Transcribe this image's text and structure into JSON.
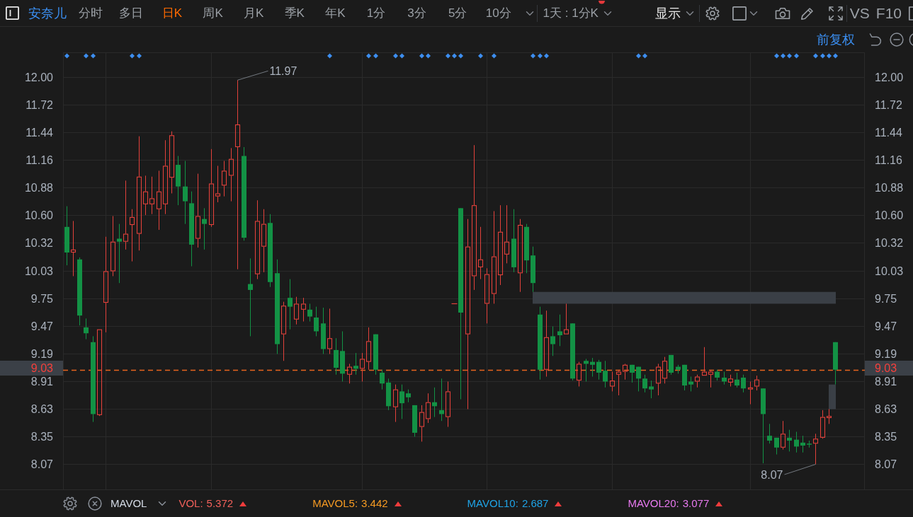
{
  "toolbar": {
    "stock_name": "安奈儿",
    "periods": [
      {
        "label": "分时",
        "selected": false
      },
      {
        "label": "多日",
        "selected": false
      },
      {
        "label": "日K",
        "selected": true
      },
      {
        "label": "周K",
        "selected": false
      },
      {
        "label": "月K",
        "selected": false
      },
      {
        "label": "季K",
        "selected": false
      },
      {
        "label": "年K",
        "selected": false
      },
      {
        "label": "1分",
        "selected": false
      },
      {
        "label": "3分",
        "selected": false
      },
      {
        "label": "5分",
        "selected": false
      },
      {
        "label": "10分",
        "selected": false
      }
    ],
    "range": {
      "label": "1天 : 1分K",
      "notification": true
    },
    "display_menu": "显示",
    "compare": "VS",
    "f10": "F10"
  },
  "subheader": {
    "adjustment": "前复权"
  },
  "left_axis": {
    "last_price": "9.03"
  },
  "chart": {
    "high_label": "11.97",
    "low_label": "8.07",
    "chart_data": {
      "type": "candlestick",
      "categories": [
        null,
        null,
        null,
        null,
        null,
        null,
        null,
        null,
        null,
        null,
        null,
        null,
        null,
        null,
        null,
        null,
        null,
        null,
        null,
        null,
        null,
        null,
        null,
        null,
        null,
        null,
        null,
        null,
        null,
        null,
        null,
        null,
        null,
        null,
        null,
        null,
        null,
        null,
        null,
        null,
        null,
        null,
        null,
        null,
        null,
        null,
        null,
        null,
        null,
        null,
        null,
        null,
        null,
        null,
        null,
        null,
        null,
        null,
        null,
        null,
        null,
        null,
        null,
        null,
        null,
        null,
        null,
        null,
        null,
        null,
        null,
        null,
        null,
        null,
        null,
        null,
        null,
        null,
        null,
        null,
        null,
        null,
        null,
        null,
        null,
        null,
        null,
        null,
        null,
        null,
        null,
        null,
        null,
        null,
        null,
        null,
        null,
        null,
        null,
        null,
        null,
        null,
        null,
        null,
        null,
        null,
        null,
        null,
        null,
        null,
        null,
        null,
        null,
        null,
        null,
        null,
        null,
        null,
        null,
        null,
        null,
        null
      ],
      "ohlc": [
        [
          10.48,
          10.69,
          10.09,
          10.22
        ],
        [
          10.22,
          10.54,
          9.98,
          10.25
        ],
        [
          10.15,
          10.17,
          9.48,
          9.58
        ],
        [
          9.46,
          9.55,
          9.34,
          9.4
        ],
        [
          9.31,
          9.37,
          8.5,
          8.58
        ],
        [
          8.57,
          9.44,
          8.56,
          9.44
        ],
        [
          9.71,
          10.38,
          9.41,
          10.03
        ],
        [
          10.03,
          10.59,
          9.98,
          10.33
        ],
        [
          10.36,
          10.51,
          9.91,
          10.33
        ],
        [
          10.33,
          10.95,
          10.25,
          10.41
        ],
        [
          10.5,
          10.66,
          10.13,
          10.58
        ],
        [
          10.41,
          11.4,
          10.24,
          10.99
        ],
        [
          10.71,
          11.0,
          10.6,
          10.84
        ],
        [
          10.71,
          10.99,
          10.61,
          10.77
        ],
        [
          10.66,
          11.05,
          10.45,
          10.84
        ],
        [
          10.71,
          11.36,
          10.61,
          11.1
        ],
        [
          10.98,
          11.45,
          10.82,
          11.41
        ],
        [
          11.11,
          11.2,
          10.7,
          10.89
        ],
        [
          10.89,
          11.15,
          10.51,
          10.74
        ],
        [
          10.72,
          10.84,
          10.08,
          10.3
        ],
        [
          10.36,
          11.02,
          10.27,
          10.59
        ],
        [
          10.56,
          10.67,
          10.25,
          10.51
        ],
        [
          10.5,
          11.27,
          10.48,
          10.92
        ],
        [
          10.79,
          11.1,
          10.73,
          10.82
        ],
        [
          10.9,
          11.15,
          10.79,
          11.05
        ],
        [
          11.0,
          11.28,
          10.74,
          11.17
        ],
        [
          11.29,
          11.97,
          10.05,
          11.52
        ],
        [
          11.2,
          11.29,
          10.34,
          10.37
        ],
        [
          9.9,
          10.16,
          9.37,
          9.84
        ],
        [
          10.0,
          10.75,
          9.95,
          10.54
        ],
        [
          10.28,
          10.66,
          10.02,
          10.51
        ],
        [
          10.52,
          10.61,
          9.87,
          9.92
        ],
        [
          10.01,
          10.15,
          9.19,
          9.29
        ],
        [
          9.39,
          9.72,
          9.12,
          9.68
        ],
        [
          9.76,
          9.95,
          9.44,
          9.67
        ],
        [
          9.54,
          9.77,
          9.49,
          9.7
        ],
        [
          9.64,
          9.76,
          9.52,
          9.7
        ],
        [
          9.64,
          9.7,
          9.52,
          9.57
        ],
        [
          9.56,
          9.67,
          9.37,
          9.42
        ],
        [
          9.5,
          9.66,
          9.19,
          9.24
        ],
        [
          9.24,
          9.65,
          9.19,
          9.35
        ],
        [
          9.23,
          9.35,
          8.98,
          9.05
        ],
        [
          9.22,
          9.42,
          8.91,
          8.99
        ],
        [
          8.98,
          9.09,
          8.89,
          9.06
        ],
        [
          9.07,
          9.2,
          8.98,
          9.04
        ],
        [
          9.04,
          9.2,
          8.91,
          9.14
        ],
        [
          9.11,
          9.46,
          9.03,
          9.32
        ],
        [
          9.39,
          9.39,
          8.98,
          9.03
        ],
        [
          9.0,
          9.03,
          8.83,
          8.89
        ],
        [
          8.9,
          8.94,
          8.62,
          8.66
        ],
        [
          8.65,
          8.88,
          8.5,
          8.83
        ],
        [
          8.81,
          8.88,
          8.53,
          8.69
        ],
        [
          8.79,
          8.83,
          8.7,
          8.75
        ],
        [
          8.67,
          8.67,
          8.35,
          8.39
        ],
        [
          8.45,
          8.67,
          8.3,
          8.6
        ],
        [
          8.53,
          8.79,
          8.49,
          8.7
        ],
        [
          8.7,
          8.85,
          8.55,
          8.66
        ],
        [
          8.62,
          8.94,
          8.51,
          8.58
        ],
        [
          8.55,
          8.91,
          8.45,
          8.81
        ],
        [
          9.7,
          9.7,
          9.7,
          9.7
        ],
        [
          10.67,
          10.67,
          8.73,
          9.61
        ],
        [
          9.39,
          10.56,
          8.63,
          10.28
        ],
        [
          9.98,
          11.31,
          9.84,
          10.7
        ],
        [
          10.07,
          10.48,
          9.95,
          10.15
        ],
        [
          9.7,
          10.06,
          9.5,
          10.0
        ],
        [
          9.8,
          10.64,
          9.7,
          10.18
        ],
        [
          9.99,
          10.7,
          9.89,
          10.43
        ],
        [
          10.2,
          10.7,
          10.11,
          10.33
        ],
        [
          10.36,
          10.66,
          10.02,
          10.07
        ],
        [
          10.01,
          10.56,
          9.82,
          10.5
        ],
        [
          10.48,
          10.51,
          10.01,
          10.14
        ],
        [
          10.19,
          10.28,
          9.82,
          9.91
        ],
        [
          9.59,
          9.67,
          8.93,
          9.03
        ],
        [
          9.03,
          9.63,
          8.96,
          9.36
        ],
        [
          9.37,
          9.47,
          9.17,
          9.29
        ],
        [
          9.42,
          9.59,
          9.27,
          9.38
        ],
        [
          9.39,
          9.7,
          9.39,
          9.44
        ],
        [
          9.5,
          9.5,
          8.92,
          8.94
        ],
        [
          8.92,
          9.11,
          8.86,
          9.09
        ],
        [
          9.12,
          9.14,
          8.91,
          9.09
        ],
        [
          9.11,
          9.15,
          8.96,
          9.08
        ],
        [
          9.11,
          9.13,
          8.93,
          9.0
        ],
        [
          9.02,
          9.12,
          8.85,
          8.91
        ],
        [
          8.86,
          9.01,
          8.81,
          8.92
        ],
        [
          8.98,
          9.03,
          8.77,
          9.01
        ],
        [
          9.01,
          9.09,
          8.93,
          9.08
        ],
        [
          9.08,
          9.08,
          8.9,
          9.0
        ],
        [
          9.06,
          9.06,
          8.81,
          8.94
        ],
        [
          8.94,
          8.98,
          8.8,
          8.84
        ],
        [
          8.86,
          8.92,
          8.74,
          8.83
        ],
        [
          8.89,
          9.09,
          8.77,
          9.06
        ],
        [
          8.94,
          9.16,
          8.89,
          9.12
        ],
        [
          9.18,
          9.18,
          8.98,
          9.0
        ],
        [
          9.06,
          9.08,
          8.99,
          9.03
        ],
        [
          9.08,
          9.08,
          8.82,
          8.87
        ],
        [
          8.91,
          8.96,
          8.81,
          8.88
        ],
        [
          8.91,
          8.98,
          8.85,
          8.96
        ],
        [
          8.97,
          9.26,
          8.97,
          9.01
        ],
        [
          8.98,
          9.03,
          8.85,
          9.01
        ],
        [
          9.01,
          9.03,
          8.92,
          8.95
        ],
        [
          8.95,
          9.01,
          8.88,
          8.91
        ],
        [
          8.9,
          8.98,
          8.86,
          8.94
        ],
        [
          8.93,
          9.0,
          8.85,
          8.87
        ],
        [
          8.95,
          8.98,
          8.8,
          8.84
        ],
        [
          8.83,
          8.91,
          8.68,
          8.85
        ],
        [
          8.86,
          8.97,
          8.82,
          8.93
        ],
        [
          8.84,
          8.84,
          8.08,
          8.58
        ],
        [
          8.36,
          8.48,
          8.28,
          8.31
        ],
        [
          8.34,
          8.34,
          8.17,
          8.24
        ],
        [
          8.24,
          8.51,
          8.22,
          8.38
        ],
        [
          8.34,
          8.42,
          8.2,
          8.31
        ],
        [
          8.32,
          8.4,
          8.19,
          8.25
        ],
        [
          8.29,
          8.36,
          8.19,
          8.26
        ],
        [
          8.28,
          8.31,
          8.24,
          8.27
        ],
        [
          8.28,
          8.38,
          8.07,
          8.33
        ],
        [
          8.34,
          8.62,
          8.33,
          8.55
        ],
        [
          8.54,
          8.63,
          8.48,
          8.56
        ],
        [
          9.31,
          9.31,
          8.88,
          9.03
        ],
        null,
        null,
        null,
        null
      ],
      "ylim": [
        7.815,
        12.252
      ],
      "yticks": [
        {
          "value": 12,
          "label": "12.00"
        },
        11.72,
        11.44,
        11.16,
        10.88,
        {
          "value": 10.6,
          "label": "10.60"
        },
        10.32,
        10.03,
        9.75,
        9.47,
        9.19,
        8.91,
        8.63,
        8.35,
        8.07
      ],
      "grid": true,
      "ref_lines": [
        {
          "axis": "y",
          "value": 9.03
        }
      ],
      "bands": [
        {
          "axis": "y",
          "from": 9.7,
          "to": 9.82
        }
      ]
    }
  },
  "right_axis": {
    "ticks": [
      "12.00",
      "11.72",
      "11.44",
      "11.16",
      "10.88",
      "10.60",
      "10.32",
      "10.03",
      "9.75",
      "9.47",
      "9.19",
      "8.91",
      "8.63",
      "8.35",
      "8.07"
    ],
    "last_price": "9.03"
  },
  "indicator_bar": {
    "indicator": "MAVOL",
    "readings": [
      {
        "label": "VOL:",
        "value": "5.372",
        "color": "#f0605a",
        "rising": true
      },
      {
        "label": "MAVOL5:",
        "value": "3.442",
        "color": "#f59a23",
        "rising": true
      },
      {
        "label": "MAVOL10:",
        "value": "2.687",
        "color": "#1fa3e6",
        "rising": true
      },
      {
        "label": "MAVOL20:",
        "value": "3.077",
        "color": "#e879f0",
        "rising": true
      }
    ]
  }
}
